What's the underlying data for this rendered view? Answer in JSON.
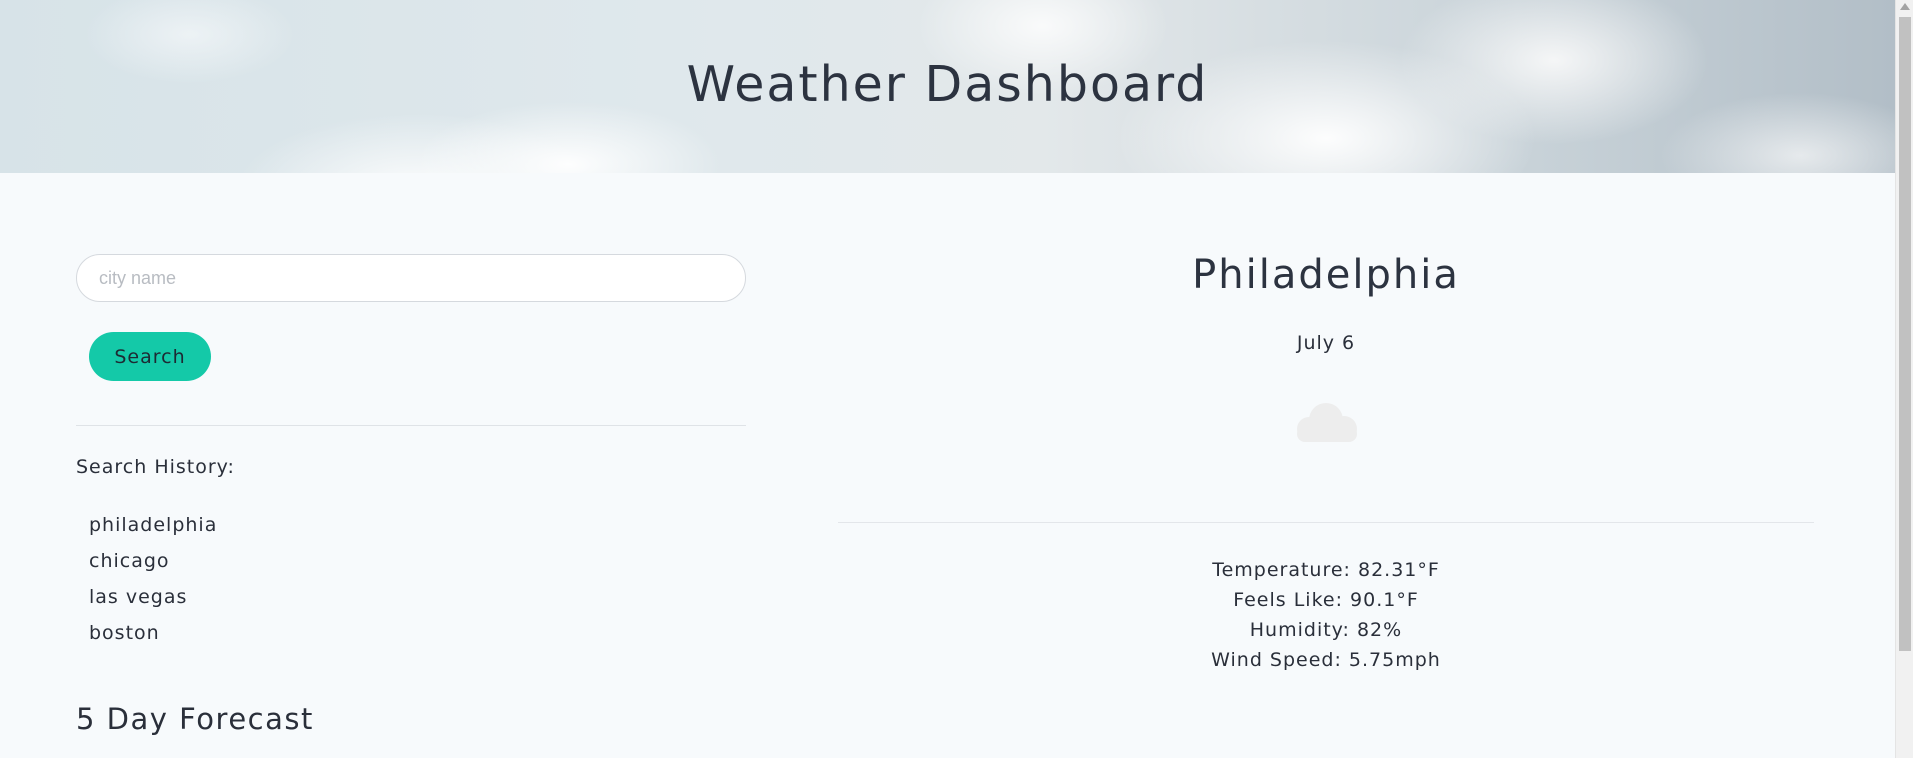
{
  "header": {
    "title": "Weather Dashboard"
  },
  "search": {
    "placeholder": "city name",
    "value": "",
    "button_label": "Search"
  },
  "history": {
    "label": "Search History:",
    "items": [
      "philadelphia",
      "chicago",
      "las vegas",
      "boston"
    ]
  },
  "forecast": {
    "title": "5 Day Forecast"
  },
  "current": {
    "city": "Philadelphia",
    "date": "July 6",
    "icon": "cloud-icon",
    "temperature": "Temperature: 82.31°F",
    "feels_like": "Feels Like: 90.1°F",
    "humidity": "Humidity: 82%",
    "wind_speed": "Wind Speed: 5.75mph"
  },
  "colors": {
    "accent": "#14c9a8",
    "background": "#f7fafc",
    "text": "#2a2f3a"
  }
}
